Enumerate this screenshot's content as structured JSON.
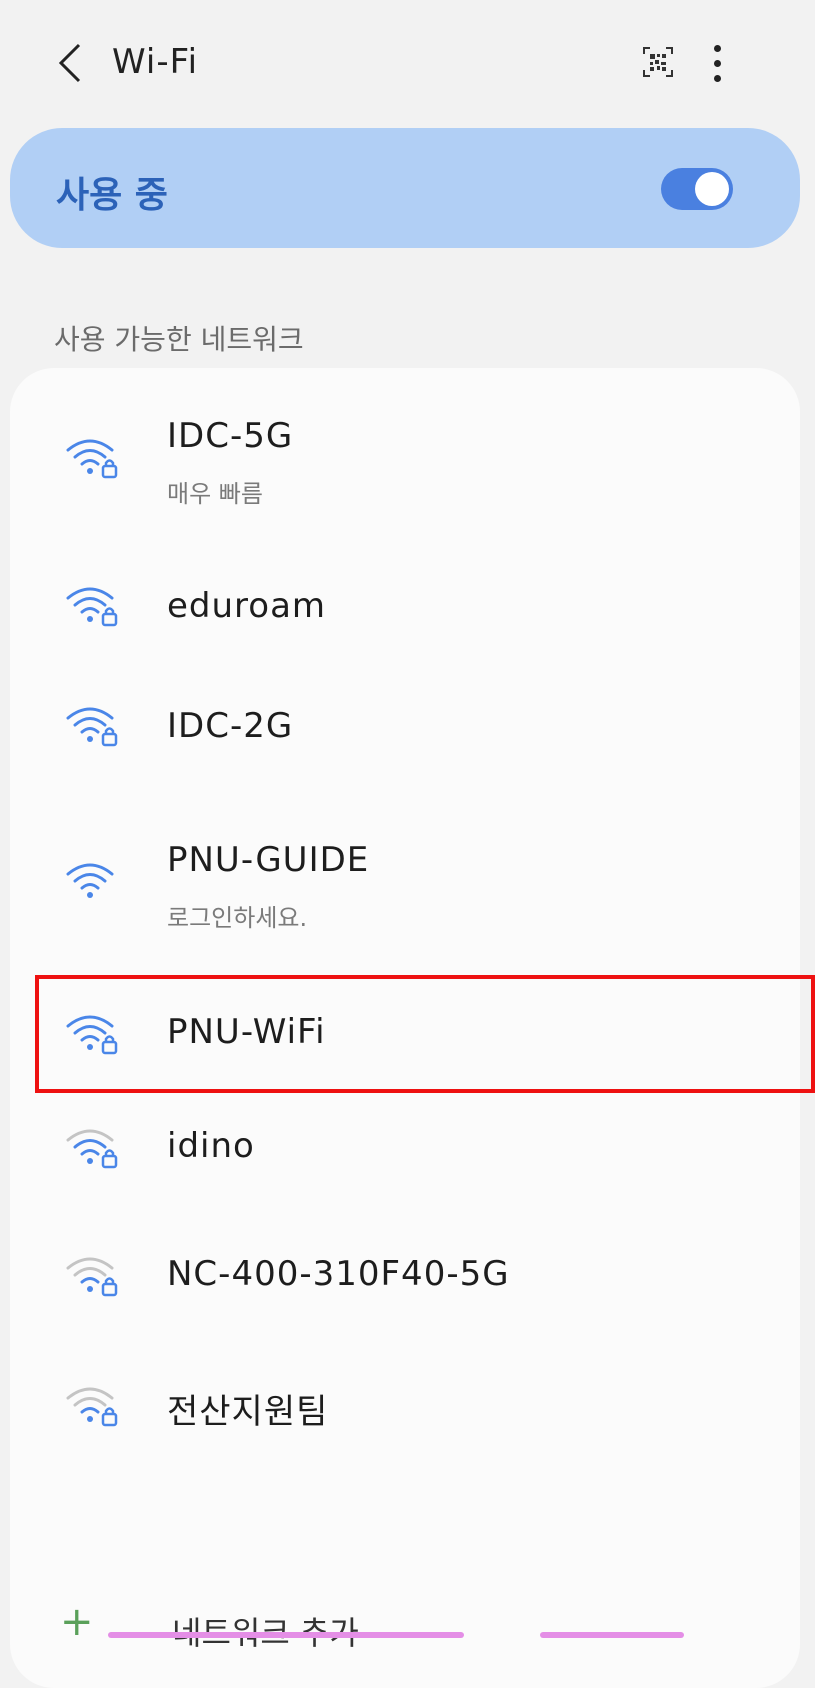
{
  "header": {
    "title": "Wi-Fi",
    "back_icon": "chevron-left-icon",
    "qr_icon": "qr-code-icon",
    "more_icon": "more-vert-icon"
  },
  "master_switch": {
    "label": "사용 중",
    "on": true,
    "accent": "#4a80e0",
    "bg": "#b1cff5"
  },
  "available": {
    "section_title": "사용 가능한 네트워크"
  },
  "networks": [
    {
      "ssid": "IDC-5G",
      "sub": "매우 빠름",
      "locked": true,
      "signal": "strong"
    },
    {
      "ssid": "eduroam",
      "sub": "",
      "locked": true,
      "signal": "strong"
    },
    {
      "ssid": "IDC-2G",
      "sub": "",
      "locked": true,
      "signal": "strong"
    },
    {
      "ssid": "PNU-GUIDE",
      "sub": "로그인하세요.",
      "locked": false,
      "signal": "strong"
    },
    {
      "ssid": "PNU-WiFi",
      "sub": "",
      "locked": true,
      "signal": "strong",
      "highlighted": true
    },
    {
      "ssid": "idino",
      "sub": "",
      "locked": true,
      "signal": "medium"
    },
    {
      "ssid": "NC-400-310F40-5G",
      "sub": "",
      "locked": true,
      "signal": "weak"
    },
    {
      "ssid": "전산지원팀",
      "sub": "",
      "locked": true,
      "signal": "weak"
    }
  ],
  "add_network": {
    "label": "네트워크 추가",
    "icon": "plus-icon"
  },
  "colors": {
    "wifi_strong": "#4a86e8",
    "wifi_weak": "#b5b5b5",
    "highlight": "#ee1111"
  }
}
